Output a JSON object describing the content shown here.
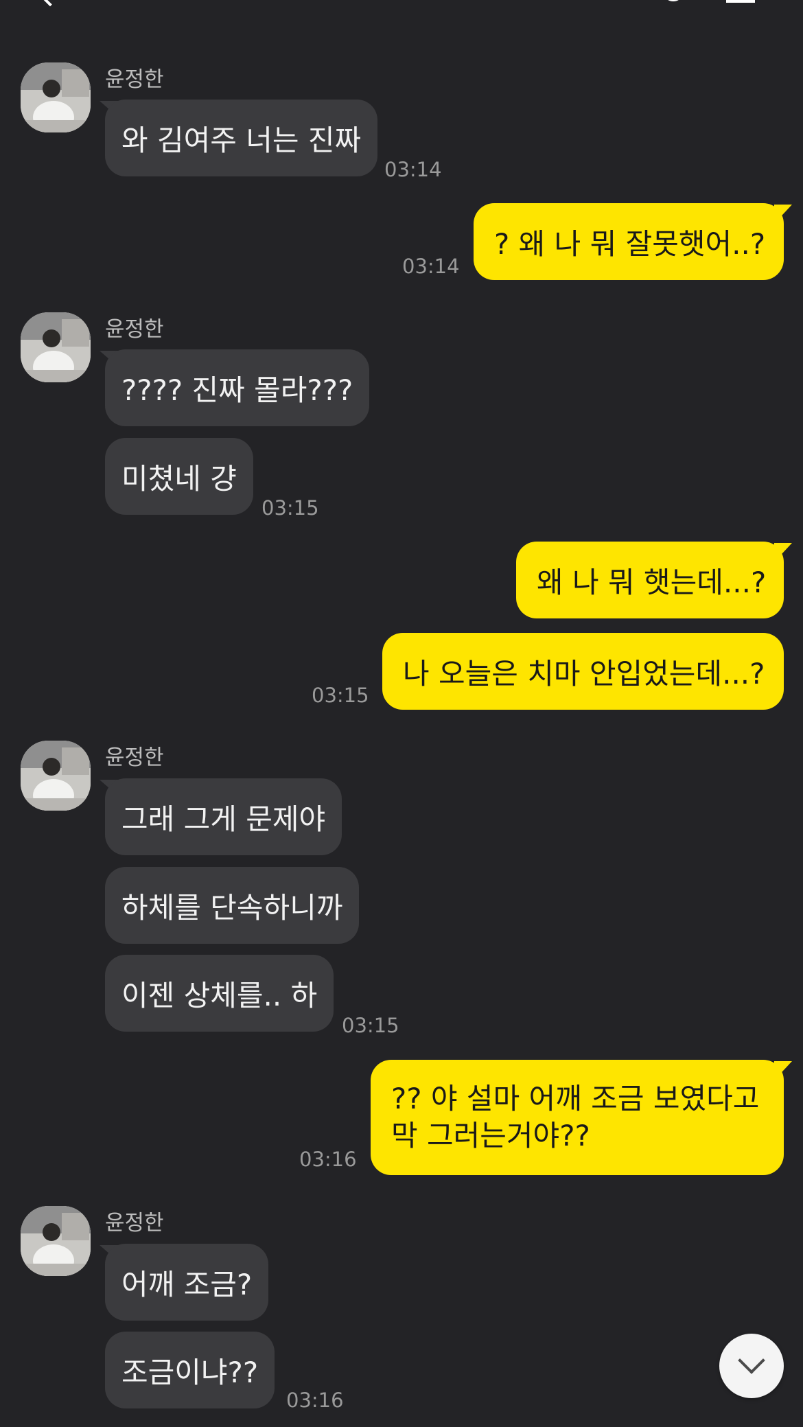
{
  "header": {
    "title": "",
    "back_icon": "chevron-left-icon",
    "search_icon": "search-icon",
    "menu_icon": "menu-icon"
  },
  "messages": {
    "m1": {
      "sender": "윤정한",
      "text": "와 김여주 너는 진짜",
      "time": "03:14"
    },
    "m2": {
      "text": "? 왜 나 뭐 잘못햇어..?",
      "time": "03:14"
    },
    "m3": {
      "sender": "윤정한",
      "text": "???? 진짜 몰라???"
    },
    "m4": {
      "text": "미쳤네 걍",
      "time": "03:15"
    },
    "m5": {
      "text": "왜 나 뭐 햇는데...?"
    },
    "m6": {
      "text": "나 오늘은 치마 안입었는데...?",
      "time": "03:15"
    },
    "m7": {
      "sender": "윤정한",
      "text": "그래 그게 문제야"
    },
    "m8": {
      "text": "하체를 단속하니까"
    },
    "m9": {
      "text": "이젠 상체를.. 하",
      "time": "03:15"
    },
    "m10": {
      "line1": "?? 야 설마 어깨 조금 보였다고",
      "line2": "막 그러는거야??",
      "time": "03:16"
    },
    "m11": {
      "sender": "윤정한",
      "text": "어깨 조금?"
    },
    "m12": {
      "text": "조금이냐??",
      "time": "03:16"
    }
  },
  "colors": {
    "background": "#232326",
    "incoming_bubble": "#3b3b3e",
    "outgoing_bubble": "#fee500"
  },
  "scroll_button_icon": "chevron-down-icon"
}
